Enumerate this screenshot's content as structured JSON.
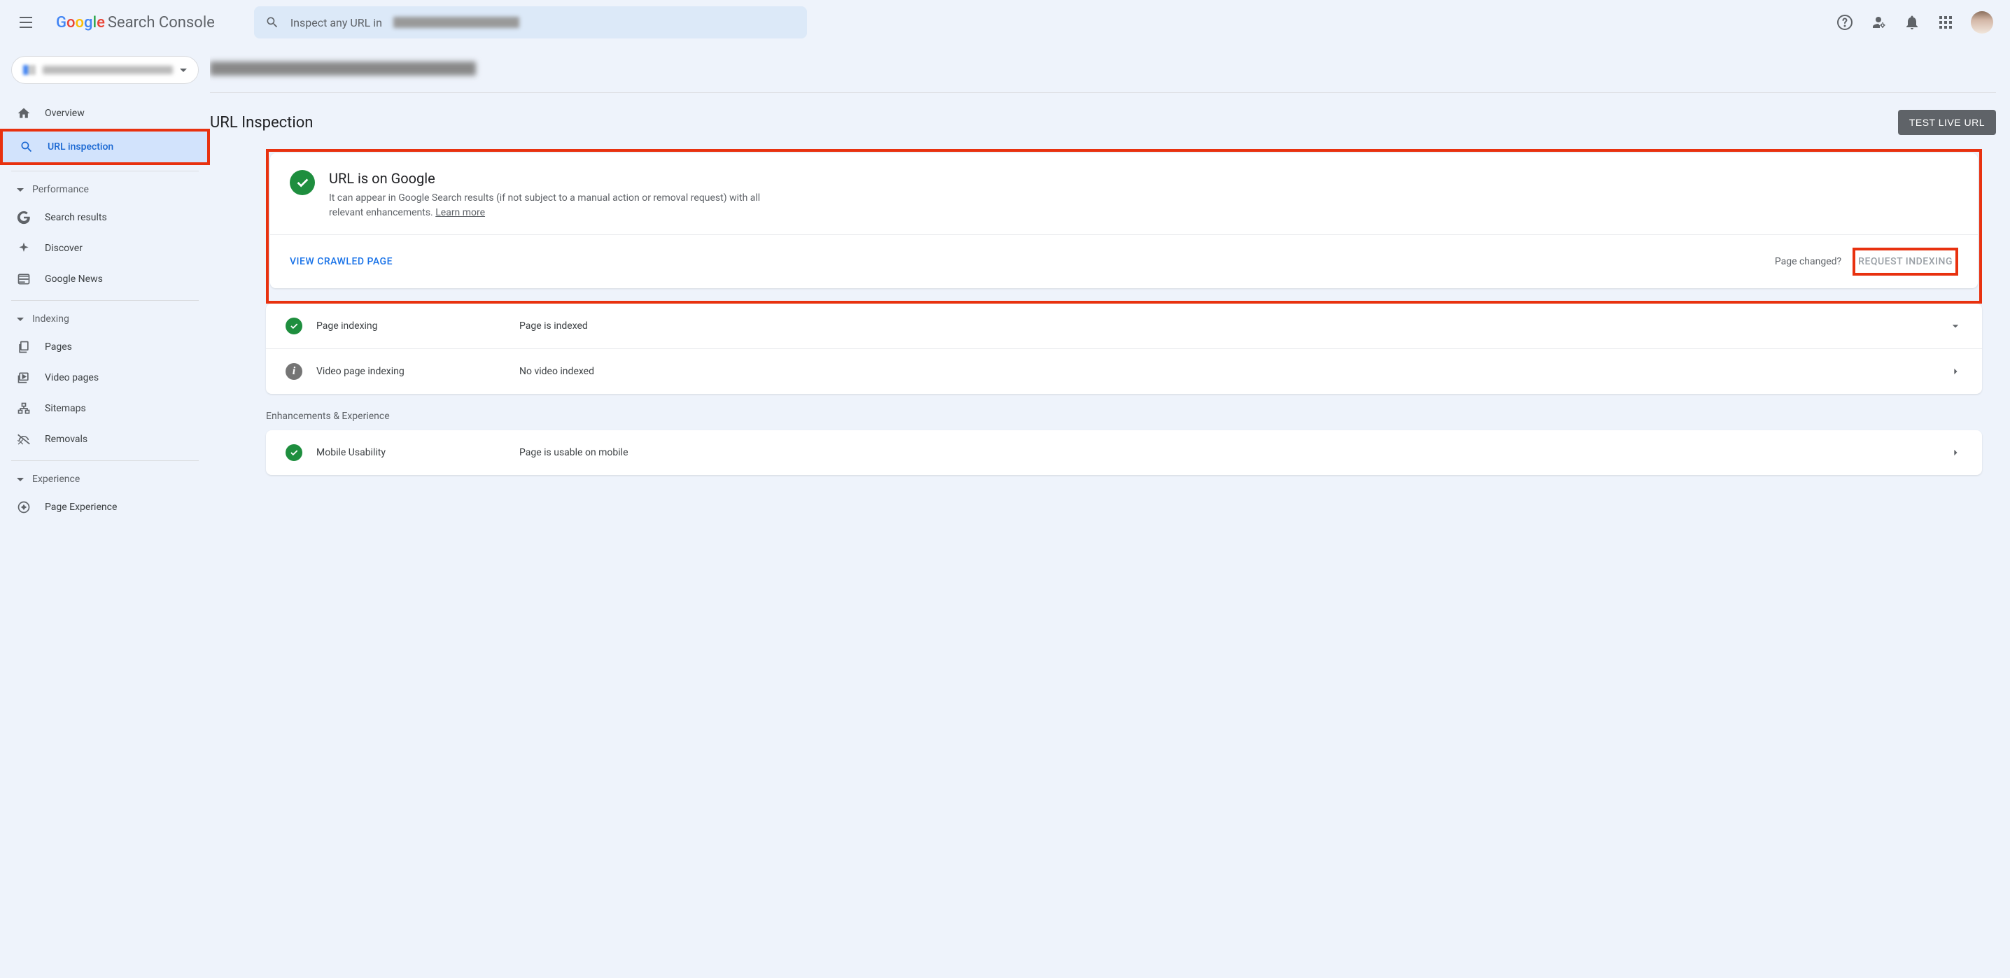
{
  "header": {
    "logo_text": "Search Console",
    "search_prefix": "Inspect any URL in "
  },
  "sidebar": {
    "overview": "Overview",
    "url_inspection": "URL inspection",
    "performance_section": "Performance",
    "search_results": "Search results",
    "discover": "Discover",
    "google_news": "Google News",
    "indexing_section": "Indexing",
    "pages": "Pages",
    "video_pages": "Video pages",
    "sitemaps": "Sitemaps",
    "removals": "Removals",
    "experience_section": "Experience",
    "page_experience": "Page Experience"
  },
  "main": {
    "page_title": "URL Inspection",
    "test_live": "TEST LIVE URL",
    "status_title": "URL is on Google",
    "status_desc": "It can appear in Google Search results (if not subject to a manual action or removal request) with all relevant enhancements. ",
    "learn_more": "Learn more",
    "view_crawled": "VIEW CRAWLED PAGE",
    "page_changed": "Page changed?",
    "request_indexing": "REQUEST INDEXING",
    "rows": [
      {
        "label": "Page indexing",
        "value": "Page is indexed",
        "icon": "check",
        "chevron": "down"
      },
      {
        "label": "Video page indexing",
        "value": "No video indexed",
        "icon": "info",
        "chevron": "right"
      }
    ],
    "enhancements_label": "Enhancements & Experience",
    "enhancement_rows": [
      {
        "label": "Mobile Usability",
        "value": "Page is usable on mobile",
        "icon": "check",
        "chevron": "right"
      }
    ]
  }
}
